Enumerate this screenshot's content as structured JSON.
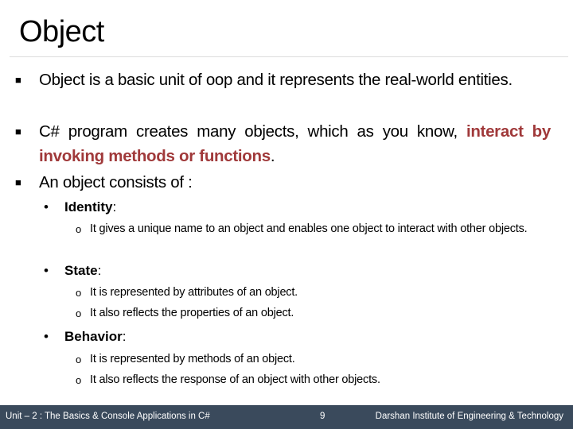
{
  "title": "Object",
  "bullets": [
    {
      "text": "Object is a basic unit of oop and it represents the real-world entities."
    },
    {
      "text_before": "C# program creates many objects, which as you know, ",
      "highlight": "interact by invoking methods or functions",
      "text_after": "."
    },
    {
      "text": "An object consists of :"
    }
  ],
  "components": [
    {
      "name": "Identity",
      "suffix": ":",
      "points": [
        "It gives a unique name to an object and enables one object to interact with other objects."
      ]
    },
    {
      "name": "State",
      "suffix": ":",
      "points": [
        "It is represented by attributes of an object.",
        "It also reflects the properties of an object."
      ]
    },
    {
      "name": "Behavior",
      "suffix": ":",
      "points": [
        "It is represented by methods of an object.",
        "It also reflects the response of an object with other objects."
      ]
    }
  ],
  "glyphs": {
    "square_bullet": "■",
    "dot_bullet": "•",
    "circle_bullet": "o"
  },
  "colors": {
    "highlight": "#a0393a",
    "footer_bg": "#3a4a5c"
  },
  "footer": {
    "left": "Unit – 2 : The Basics & Console Applications in C#",
    "page": "9",
    "right": "Darshan Institute of Engineering & Technology"
  }
}
